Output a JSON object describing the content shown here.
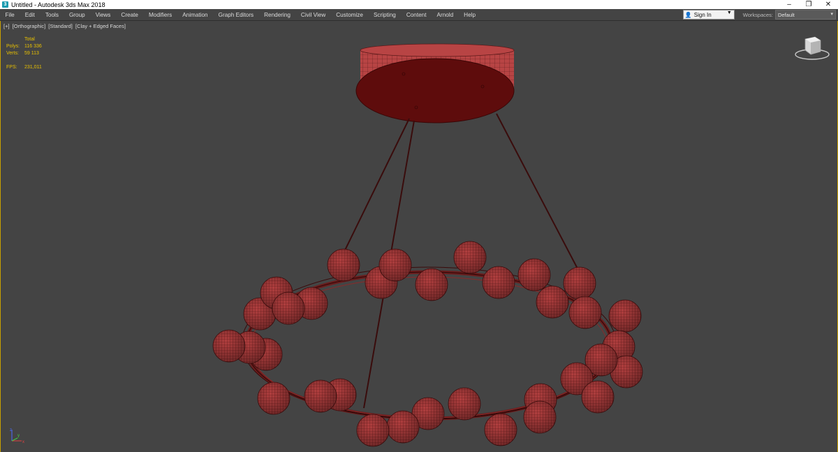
{
  "window": {
    "title": "Untitled - Autodesk 3ds Max 2018",
    "controls": {
      "minimize": "–",
      "restore": "❐",
      "close": "✕"
    }
  },
  "menu": {
    "items": [
      "File",
      "Edit",
      "Tools",
      "Group",
      "Views",
      "Create",
      "Modifiers",
      "Animation",
      "Graph Editors",
      "Rendering",
      "Civil View",
      "Customize",
      "Scripting",
      "Content",
      "Arnold",
      "Help"
    ],
    "signin_label": "Sign In",
    "workspaces_label": "Workspaces:",
    "workspace_value": "Default"
  },
  "viewport": {
    "labels": [
      "[+]",
      "[Orthographic]",
      "[Standard]",
      "[Clay + Edged Faces]"
    ],
    "stats": {
      "header": "Total",
      "polys_label": "Polys:",
      "polys_value": "116 336",
      "verts_label": "Verts:",
      "verts_value": "59 113",
      "fps_label": "FPS:",
      "fps_value": "231,011"
    },
    "axis_labels": {
      "x": "x",
      "y": "y",
      "z": "z"
    }
  },
  "colors": {
    "object": "#b04040",
    "wire": "#4a1414",
    "selection_border": "#c8a000",
    "stats_text": "#e8c000"
  }
}
